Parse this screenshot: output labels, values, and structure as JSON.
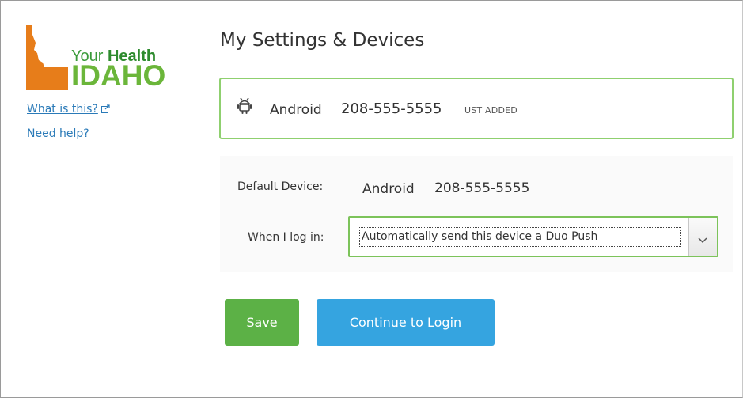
{
  "sidebar": {
    "logo": {
      "line1_prefix": "Your ",
      "line1_emphasis": "Health",
      "line2": "IDAHO",
      "colors": {
        "state": "#e77d1a",
        "green": "#6bb63a"
      }
    },
    "links": {
      "what_is_this": "What is this?",
      "need_help": "Need help?"
    }
  },
  "main": {
    "title": "My Settings & Devices",
    "device": {
      "icon": "android-icon",
      "name": "Android",
      "number": "208-555-5555",
      "status": "UST ADDED"
    },
    "settings": {
      "default_device_label": "Default Device:",
      "default_device_name": "Android",
      "default_device_number": "208-555-5555",
      "login_label": "When I log in:",
      "login_selected": "Automatically send this device a Duo Push"
    },
    "buttons": {
      "save": "Save",
      "continue": "Continue to Login"
    }
  },
  "colors": {
    "accent_green": "#5cb146",
    "accent_blue": "#35a4e0",
    "highlight_border": "#8fd06f",
    "link": "#2a7ab8"
  }
}
